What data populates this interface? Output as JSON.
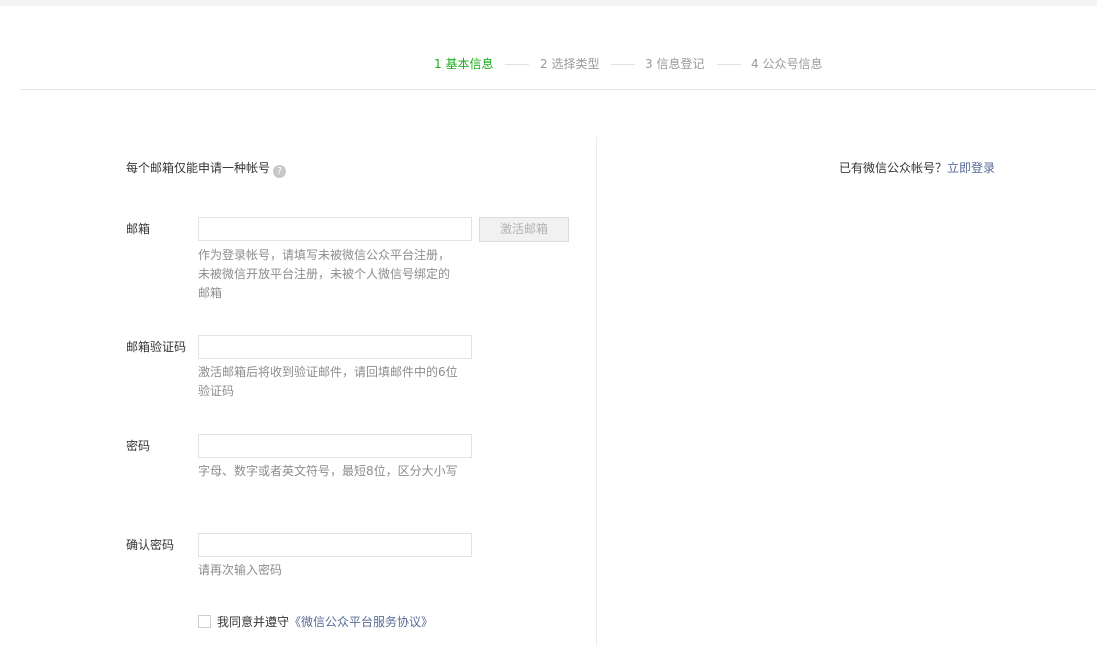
{
  "steps": [
    {
      "label": "1 基本信息",
      "active": true
    },
    {
      "label": "2 选择类型",
      "active": false
    },
    {
      "label": "3 信息登记",
      "active": false
    },
    {
      "label": "4 公众号信息",
      "active": false
    }
  ],
  "notice": {
    "text": "每个邮箱仅能申请一种帐号",
    "help_icon": "?"
  },
  "login": {
    "prompt": "已有微信公众帐号？",
    "link": "立即登录"
  },
  "form": {
    "email": {
      "label": "邮箱",
      "value": "",
      "tip": "作为登录帐号，请填写未被微信公众平台注册，未被微信开放平台注册，未被个人微信号绑定的邮箱",
      "activate_button": "激活邮箱"
    },
    "code": {
      "label": "邮箱验证码",
      "value": "",
      "tip": "激活邮箱后将收到验证邮件，请回填邮件中的6位验证码"
    },
    "password": {
      "label": "密码",
      "value": "",
      "tip": "字母、数字或者英文符号，最短8位，区分大小写"
    },
    "confirm": {
      "label": "确认密码",
      "value": "",
      "tip": "请再次输入密码"
    },
    "agree": {
      "checked": false,
      "text": "我同意并遵守",
      "link": "《微信公众平台服务协议》"
    }
  },
  "colors": {
    "active_step": "#1aad19",
    "link": "#576b95",
    "tip": "#8d8d8d"
  }
}
